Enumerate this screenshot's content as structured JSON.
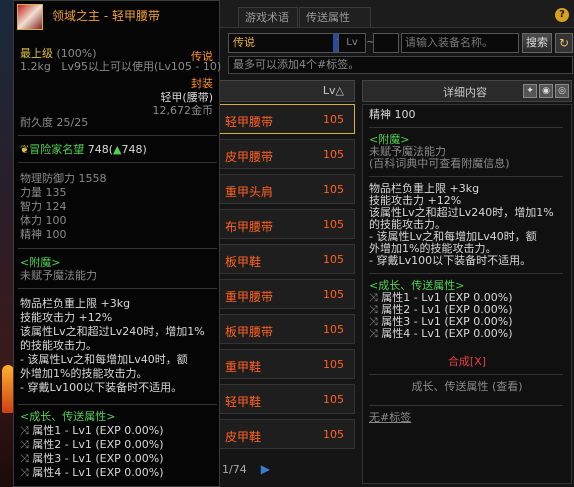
{
  "tooltip": {
    "title": "领域之主 - 轻甲腰带",
    "grade": "最上级",
    "grade_pct": "(100%)",
    "rarity": "传说",
    "weight": "1.2kg",
    "level_req": "Lv95以上可以使用(Lv105 - 10)",
    "seal": "封装",
    "type": "轻甲(腰带)",
    "price": "12,672金币",
    "durability": "耐久度 25/25",
    "fame_label": "冒险家名望",
    "fame_value": "748(",
    "fame_arrow": "▲",
    "fame_up": "748)",
    "stats": [
      "物理防御力 1558",
      "力量 135",
      "智力 124",
      "体力 100",
      "精神 100"
    ],
    "enchant_title": "<附魔>",
    "enchant_desc": "未赋予魔法能力",
    "effects": [
      "物品栏负重上限 +3kg",
      "技能攻击力 +12%",
      "该属性Lv之和超过Lv240时，增加1%",
      "的技能攻击力。",
      "- 该属性Lv之和每增加Lv40时，额",
      "外增加1%的技能攻击力。",
      "- 穿戴Lv100以下装备时不适用。"
    ],
    "growth_title": "<成长、传送属性>",
    "growth": [
      "属性1 - Lv1 (EXP 0.00%)",
      "属性2 - Lv1 (EXP 0.00%)",
      "属性3 - Lv1 (EXP 0.00%)",
      "属性4 - Lv1 (EXP 0.00%)"
    ]
  },
  "window": {
    "tabs": [
      "游戏术语",
      "传送属性"
    ],
    "help": "?",
    "filter_select": "传说",
    "lv_label": "Lv",
    "tilde": "~",
    "search_placeholder": "请输入装备名称。",
    "search_btn": "搜索",
    "refresh_icon": "↻",
    "tag_hint": "最多可以添加4个#标签。",
    "list_header_lv": "Lv△",
    "list_rows": [
      {
        "name": "轻甲腰带",
        "lv": "105"
      },
      {
        "name": "皮甲腰带",
        "lv": "105"
      },
      {
        "name": "重甲头肩",
        "lv": "105"
      },
      {
        "name": "布甲腰带",
        "lv": "105"
      },
      {
        "name": "板甲鞋",
        "lv": "105"
      },
      {
        "name": "重甲腰带",
        "lv": "105"
      },
      {
        "name": "板甲腰带",
        "lv": "105"
      },
      {
        "name": "重甲鞋",
        "lv": "105"
      },
      {
        "name": "轻甲鞋",
        "lv": "105"
      },
      {
        "name": "皮甲鞋",
        "lv": "105"
      }
    ],
    "pager": "1/74",
    "pager_next": "▶",
    "detail_title": "详细内容",
    "detail": {
      "stat": "精神 100",
      "enchant_title": "<附魔>",
      "enchant_desc": "未赋予魔法能力",
      "enchant_hint": "(百科词典中可查看附魔信息)",
      "effects": [
        "物品栏负重上限 +3kg",
        "技能攻击力 +12%",
        "该属性Lv之和超过Lv240时，增加1%",
        "的技能攻击力。",
        "- 该属性Lv之和每增加Lv40时，额",
        "外增加1%的技能攻击力。",
        "- 穿戴Lv100以下装备时不适用。"
      ],
      "growth_title": "<成长、传送属性>",
      "growth": [
        "属性1 - Lv1 (EXP 0.00%)",
        "属性2 - Lv1 (EXP 0.00%)",
        "属性3 - Lv1 (EXP 0.00%)",
        "属性4 - Lv1 (EXP 0.00%)"
      ],
      "compose": "合成[X]",
      "growth_view": "成长、传送属性 (查看)",
      "no_tag": "无#标签"
    }
  }
}
